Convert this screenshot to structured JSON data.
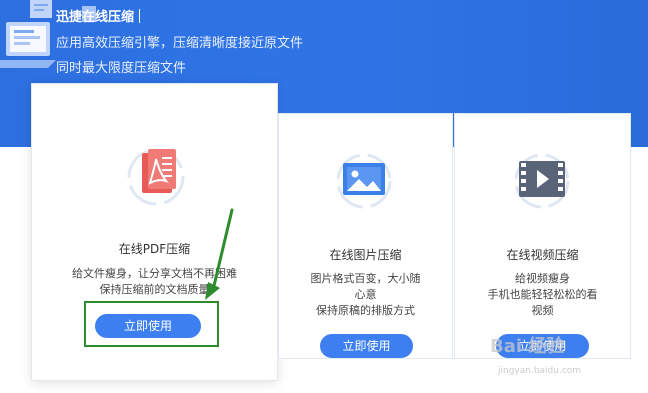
{
  "hero": {
    "title": "迅捷在线压缩",
    "line1": "应用高效压缩引擎，压缩清晰度接近原文件",
    "line2": "同时最大限度压缩文件"
  },
  "cards": {
    "pdf": {
      "title": "在线PDF压缩",
      "desc1": "给文件瘦身，让分享文档不再困难",
      "desc2": "保持压缩前的文档质量",
      "button": "立即使用",
      "icon_color": "#e85a55"
    },
    "image": {
      "title": "在线图片压缩",
      "desc1": "图片格式百变，大小随",
      "desc2": "心意",
      "desc3": "保持原稿的排版方式",
      "button": "立即使用",
      "icon_color": "#3b7fe8"
    },
    "video": {
      "title": "在线视频压缩",
      "desc1": "给视频瘦身",
      "desc2": "手机也能轻轻松松的看",
      "desc3": "视频",
      "button": "立即使用",
      "icon_color": "#5a6478"
    }
  },
  "watermark": {
    "text": "Bai 经验",
    "sub": "jingyan.baidu.com"
  },
  "colors": {
    "hero_bg": "#2f74e6",
    "button": "#3d7ff0",
    "annotation": "#2e8b2e"
  }
}
